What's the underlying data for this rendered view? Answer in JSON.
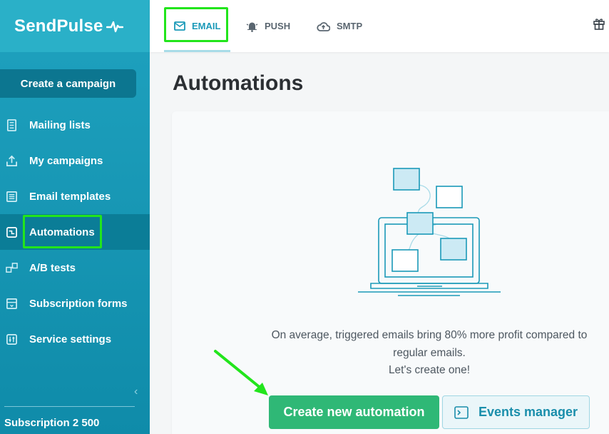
{
  "app": {
    "logo_text": "SendPulse",
    "accent_color": "#1a99b8",
    "button_green": "#2fb876"
  },
  "sidebar": {
    "create_button": "Create a campaign",
    "items": [
      {
        "label": "Mailing lists",
        "icon": "list-book-icon"
      },
      {
        "label": "My campaigns",
        "icon": "upload-tray-icon"
      },
      {
        "label": "Email templates",
        "icon": "template-icon"
      },
      {
        "label": "Automations",
        "icon": "automation-icon",
        "active": true
      },
      {
        "label": "A/B tests",
        "icon": "ab-test-icon"
      },
      {
        "label": "Subscription forms",
        "icon": "form-icon"
      },
      {
        "label": "Service settings",
        "icon": "sliders-icon"
      }
    ],
    "subscription": "Subscription 2 500"
  },
  "topbar": {
    "tabs": [
      {
        "label": "EMAIL",
        "icon": "envelope-icon",
        "active": true
      },
      {
        "label": "PUSH",
        "icon": "bell-icon"
      },
      {
        "label": "SMTP",
        "icon": "cloud-icon"
      }
    ]
  },
  "main": {
    "title": "Automations",
    "message_line1": "On average, triggered emails bring 80% more profit compared to",
    "message_line2": "regular emails.",
    "message_line3": "Let's create one!",
    "create_button": "Create new automation",
    "events_button": "Events manager"
  }
}
